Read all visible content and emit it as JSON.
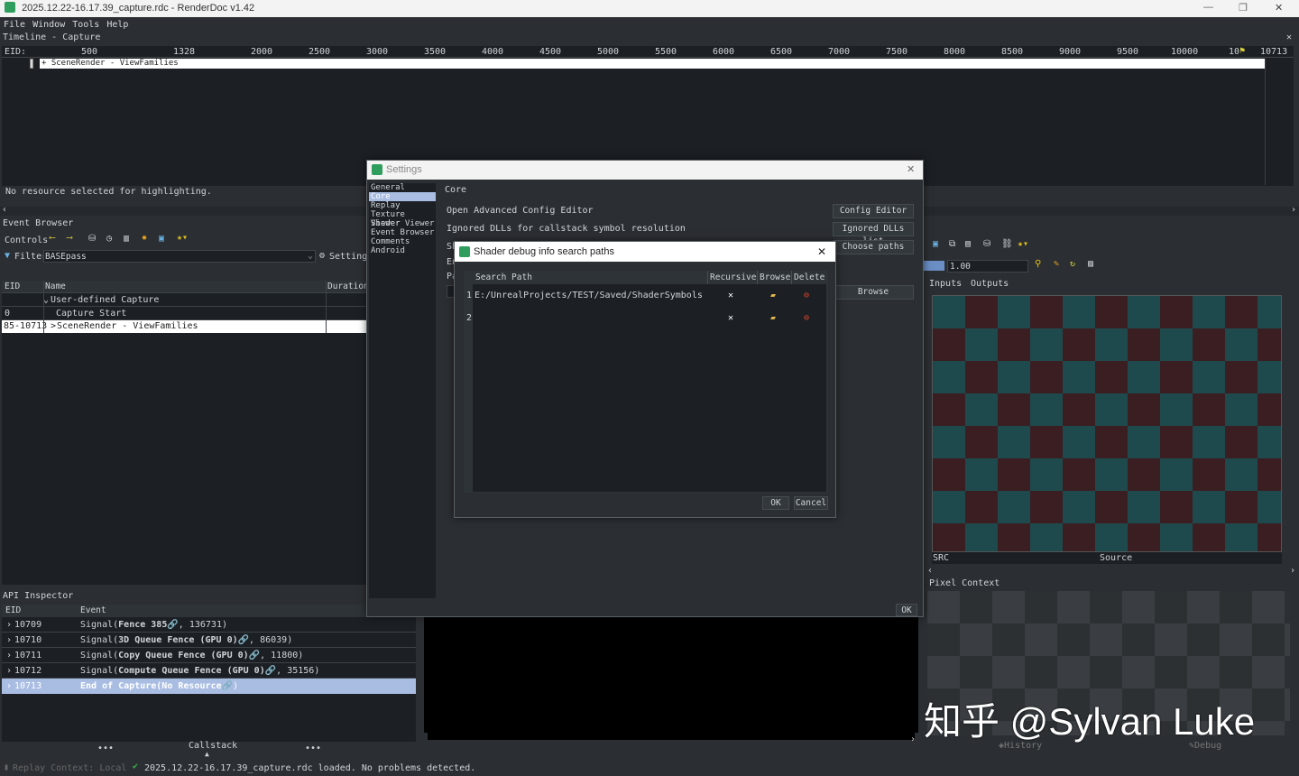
{
  "window": {
    "title": "2025.12.22-16.17.39_capture.rdc - RenderDoc v1.42",
    "min": "—",
    "max": "❐",
    "close": "✕"
  },
  "menu": [
    "File",
    "Window",
    "Tools",
    "Help"
  ],
  "timeline": {
    "title": "Timeline - Capture",
    "close": "✕",
    "eid_label": "EID:",
    "ticks": [
      "500",
      "1328",
      "2000",
      "2500",
      "3000",
      "3500",
      "4000",
      "4500",
      "5000",
      "5500",
      "6000",
      "6500",
      "7000",
      "7500",
      "8000",
      "8500",
      "9000",
      "9500",
      "10000",
      "10",
      "10713"
    ],
    "bar_label": "+ SceneRender - ViewFamilies",
    "status": "No resource selected for highlighting."
  },
  "event_browser": {
    "title": "Event Browser",
    "controls_label": "Controls",
    "filter_label": "Filter",
    "filter_value": "BASEpass",
    "settings_label": "Settings",
    "columns": [
      "EID",
      "Name",
      "Duration"
    ],
    "rows": [
      {
        "eid": "",
        "name": "User-defined Capture",
        "expand": "⌄"
      },
      {
        "eid": "0",
        "name": "Capture Start",
        "expand": ""
      },
      {
        "eid": "85-10713",
        "name": "SceneRender - ViewFamilies",
        "expand": ">"
      }
    ]
  },
  "api_inspector": {
    "title": "API Inspector",
    "columns": [
      "EID",
      "Event"
    ],
    "rows": [
      {
        "eid": "10709",
        "pre": "Signal(",
        "bold": "Fence 385",
        "post": "🔗, 136731)"
      },
      {
        "eid": "10710",
        "pre": "Signal(",
        "bold": "3D Queue Fence (GPU 0)",
        "post": "🔗, 86039)"
      },
      {
        "eid": "10711",
        "pre": "Signal(",
        "bold": "Copy Queue Fence (GPU 0)",
        "post": "🔗, 11800)"
      },
      {
        "eid": "10712",
        "pre": "Signal(",
        "bold": "Compute Queue Fence (GPU 0)",
        "post": "🔗, 35156)"
      },
      {
        "eid": "10713",
        "pre": "",
        "bold": "End of Capture(No Resource",
        "post": "🔗)"
      }
    ],
    "callstack": "Callstack",
    "dots": "•••"
  },
  "texture_viewer": {
    "zoom_value": "1.00",
    "tabs": [
      "Inputs",
      "Outputs"
    ],
    "src_label": "SRC",
    "source_label": "Source",
    "pixel_context": "Pixel Context",
    "history": "History",
    "debug": "Debug"
  },
  "settings": {
    "title": "Settings",
    "close": "✕",
    "nav": [
      "General",
      "Core",
      "Replay",
      "Texture Viewer",
      "Shader Viewer",
      "Event Browser",
      "Comments",
      "Android"
    ],
    "selected_nav": "Core",
    "section": "Core",
    "rows": [
      {
        "label": "Open Advanced Config Editor",
        "button": "Config Editor"
      },
      {
        "label": "Ignored DLLs for callstack symbol resolution",
        "button": "Ignored DLLs list"
      },
      {
        "label": "Sh",
        "button": "Choose paths"
      },
      {
        "label": "En",
        "button": ""
      },
      {
        "label": "Pa",
        "button": "Browse"
      }
    ],
    "ok": "OK"
  },
  "shader_dialog": {
    "title": "Shader debug info search paths",
    "close": "✕",
    "columns": [
      "Search Path",
      "Recursive",
      "Browse",
      "Delete"
    ],
    "rows": [
      {
        "num": "1",
        "path": "E:/UnrealProjects/TEST/Saved/ShaderSymbols",
        "recursive": "✕"
      },
      {
        "num": "2",
        "path": "",
        "recursive": "✕"
      }
    ],
    "ok": "OK",
    "cancel": "Cancel"
  },
  "status": {
    "context": "Replay Context: Local",
    "message": "2025.12.22-16.17.39_capture.rdc loaded. No problems detected."
  },
  "watermark": "知乎 @Sylvan Luke",
  "colors": {
    "accent": "#2f9d5d",
    "selection": "#a9bde3",
    "highlight": "#4e6d9a",
    "dark_bg": "#1c2024",
    "panel_bg": "#2b2f33"
  }
}
